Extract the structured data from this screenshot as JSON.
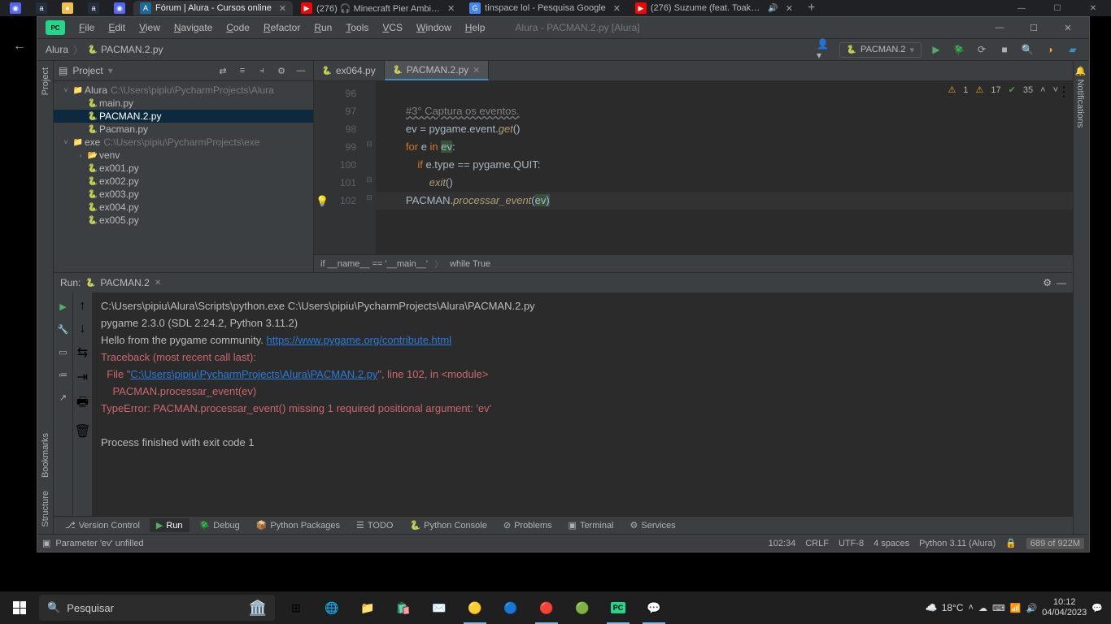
{
  "browser": {
    "tabs": [
      {
        "fav_bg": "#5865F2",
        "fav": "◉",
        "label": ""
      },
      {
        "fav_bg": "#232f3e",
        "fav": "a",
        "label": ""
      },
      {
        "fav_bg": "#f0c14b",
        "fav": "●",
        "label": ""
      },
      {
        "fav_bg": "#232f3e",
        "fav": "a",
        "label": ""
      },
      {
        "fav_bg": "#5865F2",
        "fav": "◉",
        "label": ""
      },
      {
        "fav_bg": "#1a6b98",
        "fav": "A",
        "label": "Fórum | Alura - Cursos online",
        "active": true
      },
      {
        "fav_bg": "#ff0000",
        "fav": "▶",
        "label": "(276) 🎧 Minecraft Pier Ambi…"
      },
      {
        "fav_bg": "#4285f4",
        "fav": "G",
        "label": "tinspace lol - Pesquisa Google"
      },
      {
        "fav_bg": "#ff0000",
        "fav": "▶",
        "label": "(276) Suzume (feat. Toaka…",
        "audio": true
      }
    ],
    "win_min": "—",
    "win_max": "☐",
    "win_close": "✕",
    "new_tab": "+"
  },
  "ide": {
    "title": "Alura - PACMAN.2.py [Alura]",
    "menu": [
      "File",
      "Edit",
      "View",
      "Navigate",
      "Code",
      "Refactor",
      "Run",
      "Tools",
      "VCS",
      "Window",
      "Help"
    ],
    "crumbs": [
      "Alura",
      "PACMAN.2.py"
    ],
    "run_config": "PACMAN.2",
    "project_label": "Project",
    "notifications_label": "Notifications",
    "bookmarks_label": "Bookmarks",
    "structure_label": "Structure",
    "tree": [
      {
        "indent": 0,
        "chev": "˅",
        "icon": "📁",
        "color": "",
        "name": "Alura",
        "path": "C:\\Users\\pipiu\\PycharmProjects\\Alura"
      },
      {
        "indent": 1,
        "chev": "",
        "icon": "🐍",
        "name": "main.py"
      },
      {
        "indent": 1,
        "chev": "",
        "icon": "🐍",
        "name": "PACMAN.2.py",
        "selected": true
      },
      {
        "indent": 1,
        "chev": "",
        "icon": "🐍",
        "name": "Pacman.py"
      },
      {
        "indent": 0,
        "chev": "˅",
        "icon": "📁",
        "name": "exe",
        "path": "C:\\Users\\pipiu\\PycharmProjects\\exe"
      },
      {
        "indent": 1,
        "chev": "›",
        "icon": "📂",
        "color": "#c7864d",
        "name": "venv"
      },
      {
        "indent": 1,
        "chev": "",
        "icon": "🐍",
        "name": "ex001.py"
      },
      {
        "indent": 1,
        "chev": "",
        "icon": "🐍",
        "name": "ex002.py"
      },
      {
        "indent": 1,
        "chev": "",
        "icon": "🐍",
        "name": "ex003.py"
      },
      {
        "indent": 1,
        "chev": "",
        "icon": "🐍",
        "name": "ex004.py"
      },
      {
        "indent": 1,
        "chev": "",
        "icon": "🐍",
        "name": "ex005.py"
      }
    ],
    "editor_tabs": [
      {
        "label": "ex064.py"
      },
      {
        "label": "PACMAN.2.py",
        "active": true
      }
    ],
    "gutter": [
      "96",
      "97",
      "98",
      "99",
      "100",
      "101",
      "102"
    ],
    "code": {
      "l1": " ",
      "l2_cmt": "#3° Captura os eventos.",
      "l3_pre": "        ev = pygame.event.",
      "l3_fn": "get",
      "l3_post": "()",
      "l4": "        for e in ",
      "l4_var": "ev",
      "l4_colon": ":",
      "l5": "            if e.type == pygame.QUIT:",
      "l6_pre": "                ",
      "l6_fn": "exit",
      "l6_post": "()",
      "l7_pre": "        PACMAN.",
      "l7_fn": "processar_event",
      "l7_open": "(",
      "l7_arg": "ev",
      "l7_close": ")"
    },
    "inspect": {
      "w1": "1",
      "w2": "17",
      "ok": "35"
    },
    "breadcrumb_context": [
      "if __name__ == '__main__'",
      "while True"
    ],
    "run_tool": {
      "label": "Run:",
      "config": "PACMAN.2",
      "line1": "C:\\Users\\pipiu\\Alura\\Scripts\\python.exe C:\\Users\\pipiu\\PycharmProjects\\Alura\\PACMAN.2.py",
      "line2": "pygame 2.3.0 (SDL 2.24.2, Python 3.11.2)",
      "line3_pre": "Hello from the pygame community. ",
      "line3_link": "https://www.pygame.org/contribute.html",
      "line4": "Traceback (most recent call last):",
      "line5_pre": "  File \"",
      "line5_link": "C:\\Users\\pipiu\\PycharmProjects\\Alura\\PACMAN.2.py",
      "line5_post": "\", line 102, in <module>",
      "line6": "    PACMAN.processar_event(ev)",
      "line7": "TypeError: PACMAN.processar_event() missing 1 required positional argument: 'ev'",
      "line8": "",
      "line9": "Process finished with exit code 1"
    },
    "bottom_tools": [
      "Version Control",
      "Run",
      "Debug",
      "Python Packages",
      "TODO",
      "Python Console",
      "Problems",
      "Terminal",
      "Services"
    ],
    "status": {
      "msg": "Parameter 'ev' unfilled",
      "pos": "102:34",
      "eol": "CRLF",
      "enc": "UTF-8",
      "indent": "4 spaces",
      "interp": "Python 3.11 (Alura)",
      "mem": "689 of 922M"
    }
  },
  "taskbar": {
    "search": "Pesquisar",
    "weather": "18°C",
    "time": "10:12",
    "date": "04/04/2023"
  }
}
